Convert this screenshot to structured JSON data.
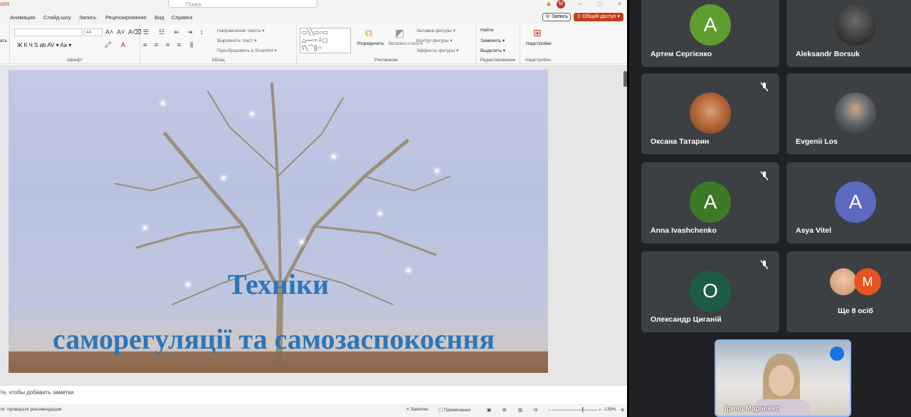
{
  "ppt": {
    "app_name": "oint",
    "search_placeholder": "Поиск",
    "account_initial": "M",
    "tabs": [
      "Анимация",
      "Слайд-шоу",
      "Запись",
      "Рецензирование",
      "Вид",
      "Справка"
    ],
    "record_button": "⦿ Запись",
    "share_button": "⎋ Общий доступ ▾",
    "ribbon": {
      "font_size": "44",
      "groups": {
        "font": "Шрифт",
        "paragraph": "Абзац",
        "drawing": "Рисование",
        "editing": "Редактирование",
        "addins": "Надстройки"
      },
      "left_cut_label": "ать",
      "font_buttons": "Ж  К  Ч  S  ab  AV ▾  Aa ▾",
      "text_direction": "Направление текста ▾",
      "align_text": "Выровнять текст ▾",
      "smartart": "Преобразовать в SmartArt ▾",
      "arrange": "Упорядочить",
      "quick_styles": "Экспресс-стили ▾",
      "shape_fill": "Заливка фигуры ▾",
      "shape_outline": "Контур фигуры ▾",
      "shape_effects": "Эффекты фигуры ▾",
      "find": "Найти",
      "replace": "Заменить ▾",
      "select": "Выделить ▾",
      "addins": "Надстройки"
    },
    "slide": {
      "title": "Техніки",
      "subtitle": "саморегуляції та самозаспокоєння"
    },
    "notes_placeholder": "те, чтобы добавить заметки",
    "status": {
      "accessibility": "те: проверьте рекомендации",
      "notes": "Заметки",
      "comments": "Примечания",
      "zoom": "139%"
    }
  },
  "meet": {
    "participants": [
      {
        "name": "Артем Сергієнко",
        "initial": "A",
        "color": "#5f9e2e"
      },
      {
        "name": "Aleksandr Borsuk",
        "initial": "",
        "color": "#2b2b2b"
      },
      {
        "name": "Оксана Татарин",
        "initial": "",
        "color": "#8a4b2a"
      },
      {
        "name": "Evgenii Los",
        "initial": "",
        "color": "#3a3f46"
      },
      {
        "name": "Anna Ivashchenko",
        "initial": "A",
        "color": "#3d7a28"
      },
      {
        "name": "Asya Vitel",
        "initial": "A",
        "color": "#5c6bc0"
      },
      {
        "name": "Олександр Циганій",
        "initial": "O",
        "color": "#1e5b46"
      }
    ],
    "more": {
      "label": "Ще 8 осіб",
      "initial": "M",
      "color": "#e8541f"
    },
    "self": {
      "name": "Ірина Марченко"
    }
  }
}
